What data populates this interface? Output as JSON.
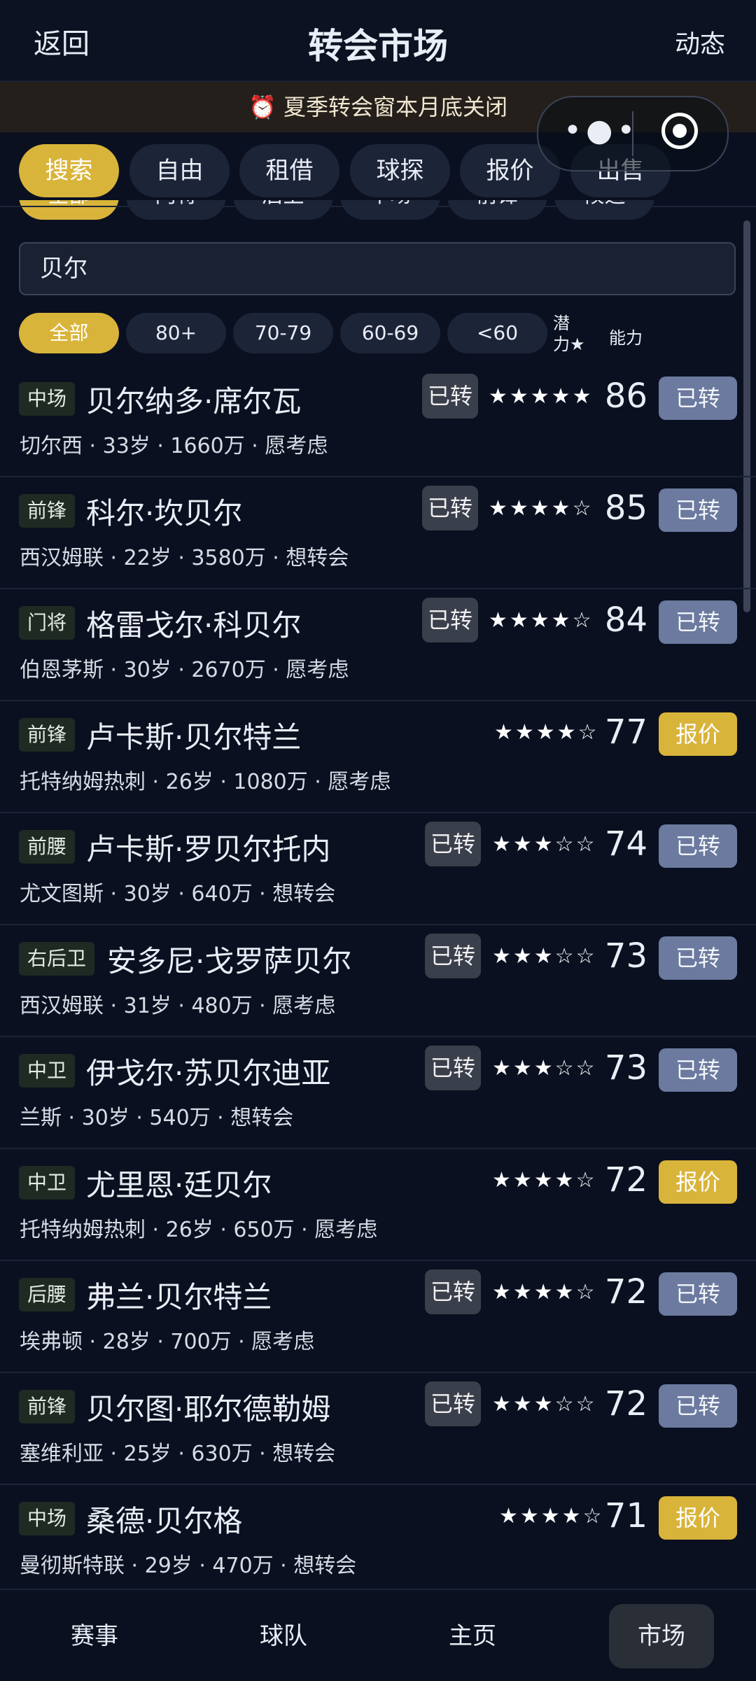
{
  "header": {
    "back": "返回",
    "title": "转会市场",
    "feed": "动态"
  },
  "banner": "⏰ 夏季转会窗本月底关闭",
  "miniapp": {
    "more_icon": "more-dots-icon",
    "close_icon": "record-circle-icon"
  },
  "tabs": [
    {
      "label": "搜索",
      "active": true
    },
    {
      "label": "自由",
      "active": false
    },
    {
      "label": "租借",
      "active": false
    },
    {
      "label": "球探",
      "active": false
    },
    {
      "label": "报价",
      "active": false
    },
    {
      "label": "出售",
      "active": false
    }
  ],
  "positions": [
    "全部",
    "门将",
    "后卫",
    "中场",
    "前锋",
    "候选"
  ],
  "search": {
    "value": "贝尔",
    "placeholder": ""
  },
  "rating_filters": [
    {
      "label": "全部",
      "active": true
    },
    {
      "label": "80+",
      "active": false
    },
    {
      "label": "70-79",
      "active": false
    },
    {
      "label": "60-69",
      "active": false
    },
    {
      "label": "<60",
      "active": false
    }
  ],
  "headers": {
    "potential_1": "潜",
    "potential_2": "力★",
    "ability": "能力"
  },
  "players": [
    {
      "pos": "中场",
      "name": "贝尔纳多·席尔瓦",
      "meta": "切尔西 · 33岁 · 1660万 · 愿考虑",
      "badge": "已转",
      "stars": "★★★★★",
      "ovr": "86",
      "action": "已转",
      "action_type": "trans"
    },
    {
      "pos": "前锋",
      "name": "科尔·坎贝尔",
      "meta": "西汉姆联 · 22岁 · 3580万 · 想转会",
      "badge": "已转",
      "stars": "★★★★☆",
      "ovr": "85",
      "action": "已转",
      "action_type": "trans"
    },
    {
      "pos": "门将",
      "name": "格雷戈尔·科贝尔",
      "meta": "伯恩茅斯 · 30岁 · 2670万 · 愿考虑",
      "badge": "已转",
      "stars": "★★★★☆",
      "ovr": "84",
      "action": "已转",
      "action_type": "trans"
    },
    {
      "pos": "前锋",
      "name": "卢卡斯·贝尔特兰",
      "meta": "托特纳姆热刺 · 26岁 · 1080万 · 愿考虑",
      "badge": "",
      "stars": "★★★★☆",
      "ovr": "77",
      "action": "报价",
      "action_type": "offer"
    },
    {
      "pos": "前腰",
      "name": "卢卡斯·罗贝尔托内",
      "meta": "尤文图斯 · 30岁 · 640万 · 想转会",
      "badge": "已转",
      "stars": "★★★☆☆",
      "ovr": "74",
      "action": "已转",
      "action_type": "trans"
    },
    {
      "pos": "右后卫",
      "name": "安多尼·戈罗萨贝尔",
      "meta": "西汉姆联 · 31岁 · 480万 · 愿考虑",
      "badge": "已转",
      "stars": "★★★☆☆",
      "ovr": "73",
      "action": "已转",
      "action_type": "trans"
    },
    {
      "pos": "中卫",
      "name": "伊戈尔·苏贝尔迪亚",
      "meta": "兰斯 · 30岁 · 540万 · 想转会",
      "badge": "已转",
      "stars": "★★★☆☆",
      "ovr": "73",
      "action": "已转",
      "action_type": "trans"
    },
    {
      "pos": "中卫",
      "name": "尤里恩·廷贝尔",
      "meta": "托特纳姆热刺 · 26岁 · 650万 · 愿考虑",
      "badge": "",
      "stars": "★★★★☆",
      "ovr": "72",
      "action": "报价",
      "action_type": "offer"
    },
    {
      "pos": "后腰",
      "name": "弗兰·贝尔特兰",
      "meta": "埃弗顿 · 28岁 · 700万 · 愿考虑",
      "badge": "已转",
      "stars": "★★★★☆",
      "ovr": "72",
      "action": "已转",
      "action_type": "trans"
    },
    {
      "pos": "前锋",
      "name": "贝尔图·耶尔德勒姆",
      "meta": "塞维利亚 · 25岁 · 630万 · 想转会",
      "badge": "已转",
      "stars": "★★★☆☆",
      "ovr": "72",
      "action": "已转",
      "action_type": "trans"
    },
    {
      "pos": "中场",
      "name": "桑德·贝尔格",
      "meta": "曼彻斯特联 · 29岁 · 470万 · 想转会",
      "badge": "",
      "stars": "★★★★☆",
      "ovr": "71",
      "action": "报价",
      "action_type": "offer"
    }
  ],
  "nav": [
    {
      "label": "赛事",
      "active": false
    },
    {
      "label": "球队",
      "active": false
    },
    {
      "label": "主页",
      "active": false
    },
    {
      "label": "市场",
      "active": true
    }
  ],
  "colors": {
    "background": "#0b1020",
    "accent": "#d9b43a",
    "transferred": "#6b7a9e"
  }
}
